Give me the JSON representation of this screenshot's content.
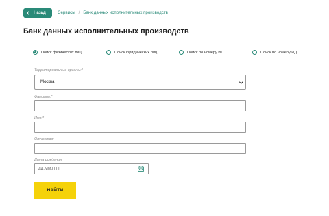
{
  "back_button": {
    "label": "Назад"
  },
  "breadcrumb": {
    "items": [
      "Сервисы",
      "Банк данных исполнительных производств"
    ],
    "separator": "/"
  },
  "page_title": "Банк данных исполнительных производств",
  "search_types": {
    "options": [
      "Поиск физических лиц",
      "Поиск юридических лиц",
      "Поиск по номеру ИП",
      "Поиск по номеру ИД"
    ],
    "selected": "Поиск физических лиц"
  },
  "form": {
    "region": {
      "label": "Территориальные органы:*",
      "value": "Москва"
    },
    "last_name": {
      "label": "Фамилия:*",
      "value": ""
    },
    "first_name": {
      "label": "Имя:*",
      "value": ""
    },
    "patronymic": {
      "label": "Отчество:",
      "value": ""
    },
    "birth_date": {
      "label": "Дата рождения:",
      "placeholder": "ДД.ММ.ГГГГ"
    },
    "submit_label": "НАЙТИ"
  },
  "colors": {
    "accent": "#2a8a78",
    "button": "#f5d20a"
  }
}
